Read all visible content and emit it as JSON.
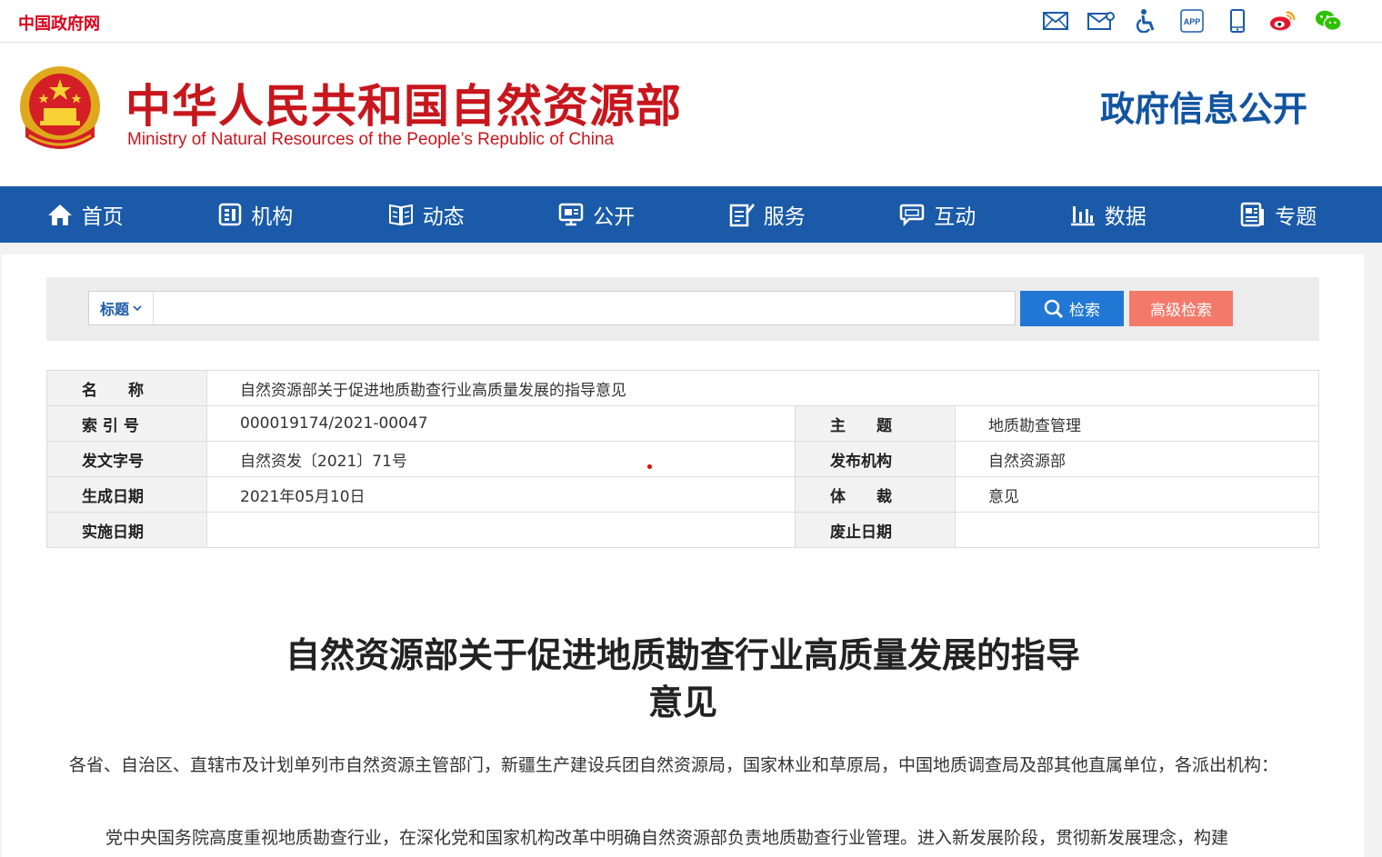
{
  "topbar": {
    "gov_link": "中国政府网",
    "icons": [
      "mail-icon",
      "mailbox-icon",
      "accessibility-icon",
      "app-icon",
      "mobile-icon",
      "weibo-icon",
      "wechat-icon"
    ],
    "app_text": "APP"
  },
  "header": {
    "title_cn": "中华人民共和国自然资源部",
    "title_en": "Ministry of Natural Resources of the People’s Republic of China",
    "section": "政府信息公开"
  },
  "nav": {
    "items": [
      {
        "label": "首页",
        "icon": "home-icon"
      },
      {
        "label": "机构",
        "icon": "organization-icon"
      },
      {
        "label": "动态",
        "icon": "news-book-icon"
      },
      {
        "label": "公开",
        "icon": "monitor-icon"
      },
      {
        "label": "服务",
        "icon": "edit-document-icon"
      },
      {
        "label": "互动",
        "icon": "chat-icon"
      },
      {
        "label": "数据",
        "icon": "bar-chart-icon"
      },
      {
        "label": "专题",
        "icon": "topic-icon"
      }
    ]
  },
  "search": {
    "scope": "标题",
    "placeholder": "",
    "search_label": "检索",
    "advanced_label": "高级检索"
  },
  "meta": {
    "name_label": "名　　称",
    "name_value": "自然资源部关于促进地质勘查行业高质量发展的指导意见",
    "index_label": "索 引 号",
    "index_value": "000019174/2021-00047",
    "topic_label": "主　　题",
    "topic_value": "地质勘查管理",
    "docno_label": "发文字号",
    "docno_value": "自然资发〔2021〕71号",
    "issuer_label": "发布机构",
    "issuer_value": "自然资源部",
    "date_label": "生成日期",
    "date_value": "2021年05月10日",
    "genre_label": "体　　裁",
    "genre_value": "意见",
    "effective_label": "实施日期",
    "effective_value": "",
    "expiry_label": "废止日期",
    "expiry_value": ""
  },
  "article": {
    "title_line1": "自然资源部关于促进地质勘查行业高质量发展的指导",
    "title_line2": "意见",
    "para1": "各省、自治区、直辖市及计划单列市自然资源主管部门，新疆生产建设兵团自然资源局，国家林业和草原局，中国地质调查局及部其他直属单位，各派出机构：",
    "para2": "党中央国务院高度重视地质勘查行业，在深化党和国家机构改革中明确自然资源部负责地质勘查行业管理。进入新发展阶段，贯彻新发展理念，构建"
  },
  "colors": {
    "brand_red": "#c8161d",
    "nav_blue": "#1a5aa8",
    "search_blue": "#2277d4",
    "advanced_salmon": "#f37a6b"
  }
}
